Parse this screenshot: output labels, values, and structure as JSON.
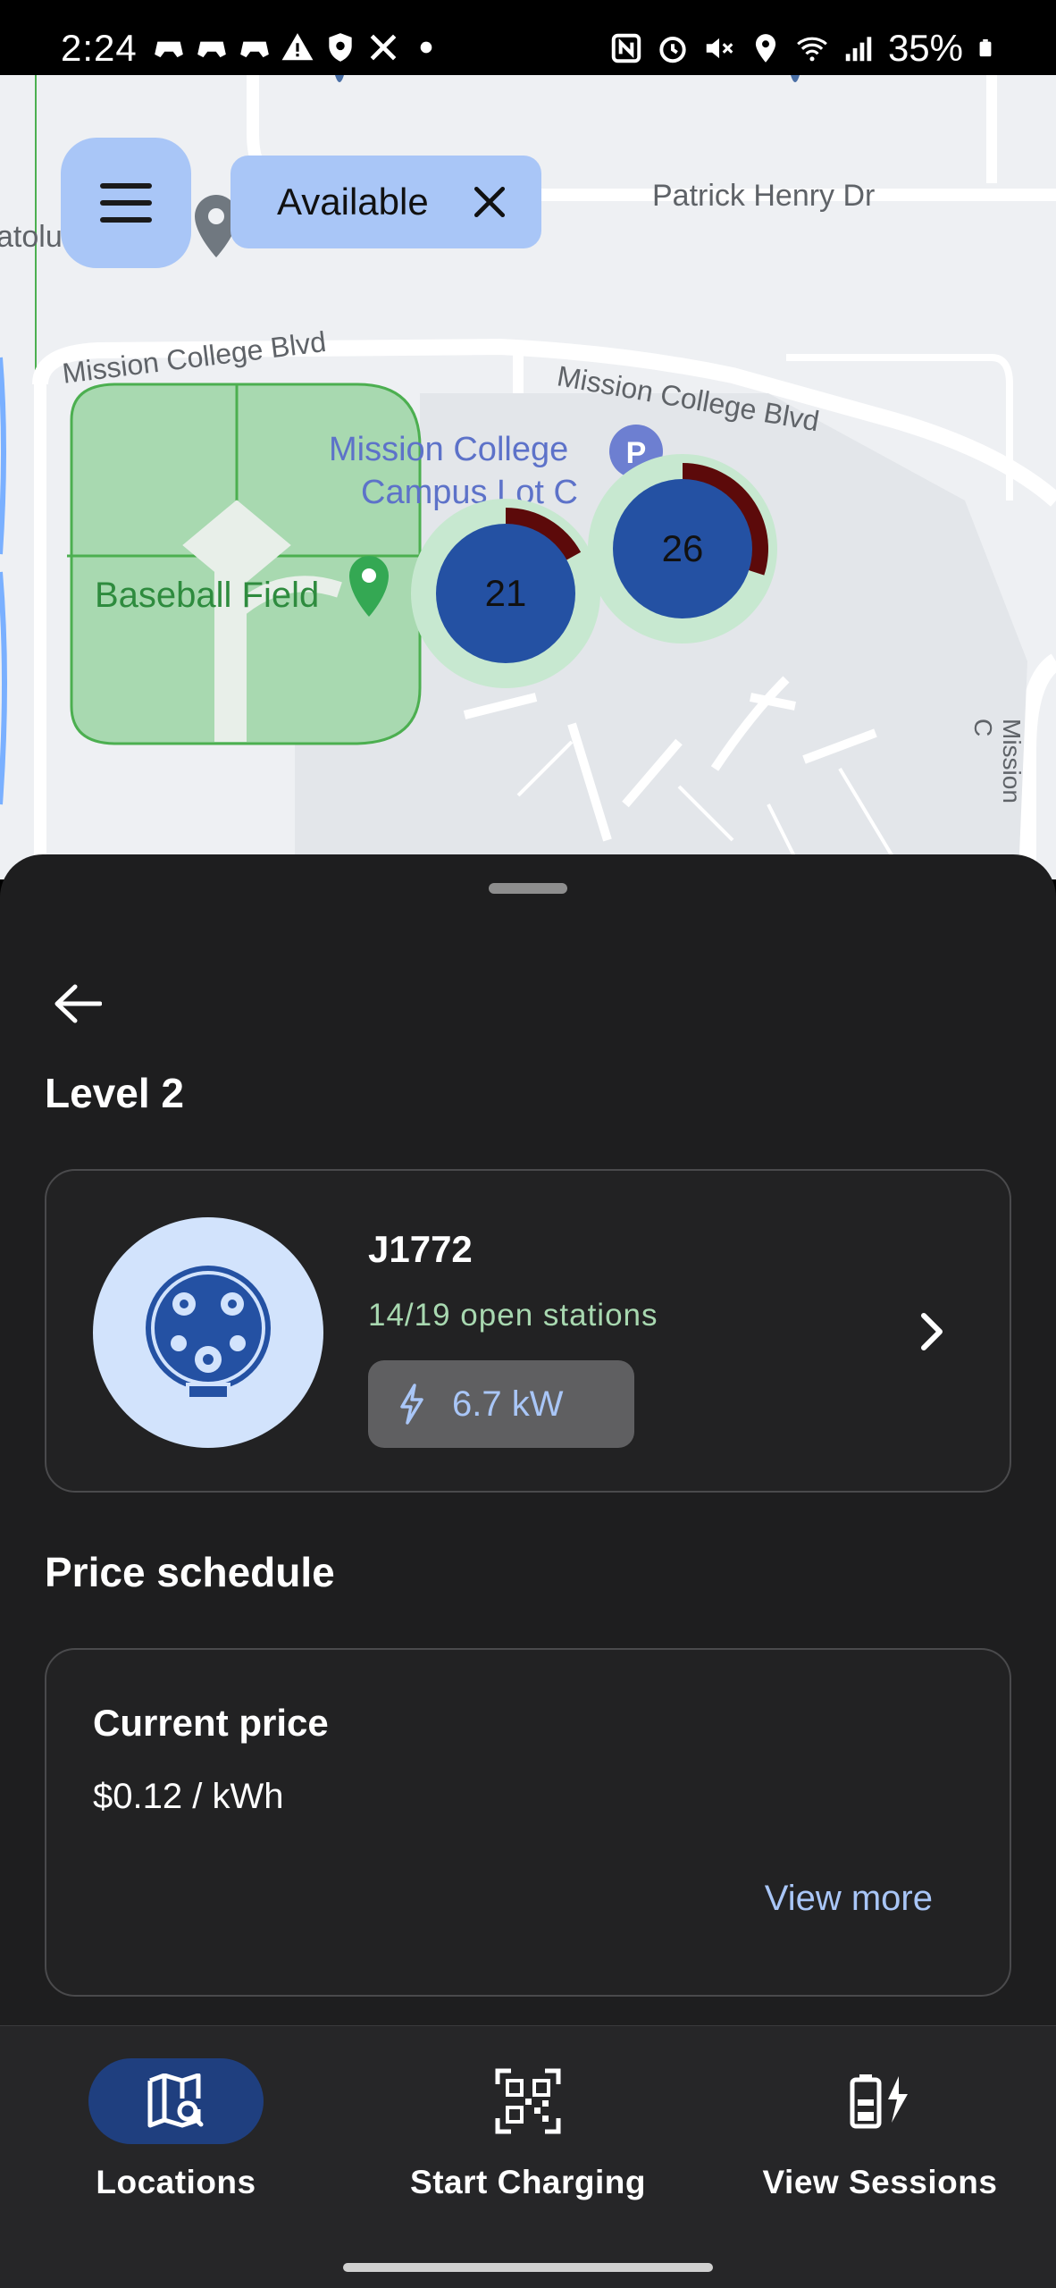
{
  "status_bar": {
    "time": "2:24",
    "battery": "35%"
  },
  "map": {
    "labels": {
      "patrick_henry": "Patrick Henry Dr",
      "mission_blvd_left": "Mission College Blvd",
      "mission_blvd_right": "Mission College Blvd",
      "campus_lot_1": "Mission College",
      "campus_lot_2": "Campus Lot C",
      "baseball": "Baseball Field",
      "left_edge": "atolu",
      "right_edge": "Mission C"
    },
    "filter_chip": "Available",
    "clusters": [
      {
        "count": "21",
        "occupied_fraction": 0.17
      },
      {
        "count": "26",
        "occupied_fraction": 0.3
      }
    ],
    "colors": {
      "cluster_fill": "#2451a3",
      "cluster_ring": "#c7e8d0",
      "occupied": "#5c0a0a"
    }
  },
  "sheet": {
    "level": "Level 2",
    "connector": {
      "name": "J1772",
      "open_stations": "14/19 open stations",
      "power": "6.7 kW",
      "icon": "j1772-plug-icon"
    },
    "price_section_title": "Price schedule",
    "price": {
      "label": "Current price",
      "value": "$0.12 / kWh",
      "view_more": "View more"
    }
  },
  "nav": {
    "items": [
      {
        "label": "Locations",
        "icon": "map-search-icon",
        "active": true
      },
      {
        "label": "Start Charging",
        "icon": "qr-code-icon",
        "active": false
      },
      {
        "label": "View Sessions",
        "icon": "battery-charging-icon",
        "active": false
      }
    ]
  }
}
